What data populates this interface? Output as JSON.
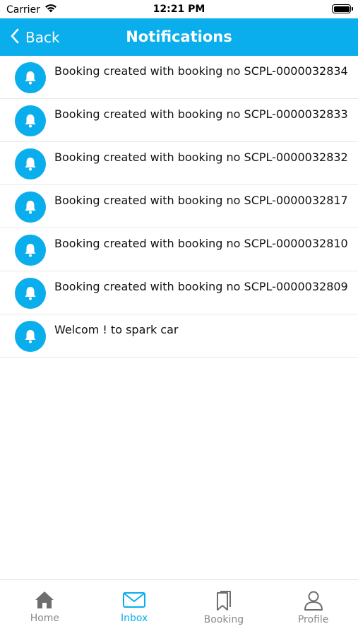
{
  "status_bar": {
    "carrier": "Carrier",
    "time": "12:21 PM"
  },
  "header": {
    "back_label": "Back",
    "title": "Notifications"
  },
  "notifications": [
    {
      "text": "Booking created with booking no SCPL-0000032834"
    },
    {
      "text": "Booking created with booking no SCPL-0000032833"
    },
    {
      "text": "Booking created with booking no SCPL-0000032832"
    },
    {
      "text": "Booking created with booking no SCPL-0000032817"
    },
    {
      "text": "Booking created with booking no SCPL-0000032810"
    },
    {
      "text": "Booking created with booking no SCPL-0000032809"
    },
    {
      "text": "Welcom ! to spark car"
    }
  ],
  "tabs": [
    {
      "label": "Home",
      "icon": "home-icon",
      "active": false
    },
    {
      "label": "Inbox",
      "icon": "inbox-icon",
      "active": true
    },
    {
      "label": "Booking",
      "icon": "bookmarks-icon",
      "active": false
    },
    {
      "label": "Profile",
      "icon": "profile-icon",
      "active": false
    }
  ],
  "colors": {
    "accent": "#0aaeec",
    "inactive_tab": "#8a8a8a"
  }
}
